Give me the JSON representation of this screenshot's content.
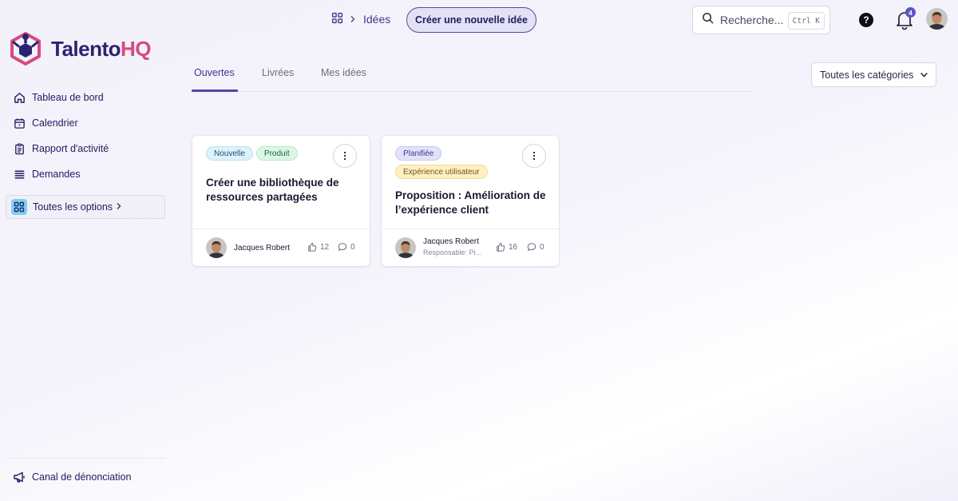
{
  "brand": {
    "name_main": "Talento",
    "name_accent": "HQ",
    "accent_color": "#d94a7e",
    "primary_color": "#2a2470"
  },
  "sidebar": {
    "items": [
      {
        "label": "Tableau de bord",
        "icon": "home-icon"
      },
      {
        "label": "Calendrier",
        "icon": "calendar-icon"
      },
      {
        "label": "Rapport d'activité",
        "icon": "clipboard-icon"
      },
      {
        "label": "Demandes",
        "icon": "stack-icon"
      }
    ],
    "all_options_label": "Toutes les options",
    "footer_label": "Canal de dénonciation"
  },
  "topbar": {
    "breadcrumb_label": "Idées",
    "new_idea_label": "Créer une nouvelle idée",
    "search_placeholder": "Recherche...",
    "search_shortcut": "Ctrl K",
    "help_label": "?",
    "notifications_count": "4"
  },
  "tabs": [
    {
      "label": "Ouvertes",
      "active": true
    },
    {
      "label": "Livrées",
      "active": false
    },
    {
      "label": "Mes idées",
      "active": false
    }
  ],
  "category_filter": {
    "selected": "Toutes les catégories"
  },
  "cards": [
    {
      "tags": [
        {
          "label": "Nouvelle",
          "color": "blue"
        },
        {
          "label": "Produit",
          "color": "green"
        }
      ],
      "title": "Créer une bibliothèque de ressources partagées",
      "author": "Jacques Robert",
      "responsible": "",
      "likes": "12",
      "comments": "0"
    },
    {
      "tags": [
        {
          "label": "Planifiée",
          "color": "indigo"
        },
        {
          "label": "Expérience utilisateur",
          "color": "yellow"
        }
      ],
      "title": "Proposition : Amélioration de l’expérience client",
      "author": "Jacques Robert",
      "responsible": "Responsable: Pi...",
      "likes": "16",
      "comments": "0"
    }
  ]
}
